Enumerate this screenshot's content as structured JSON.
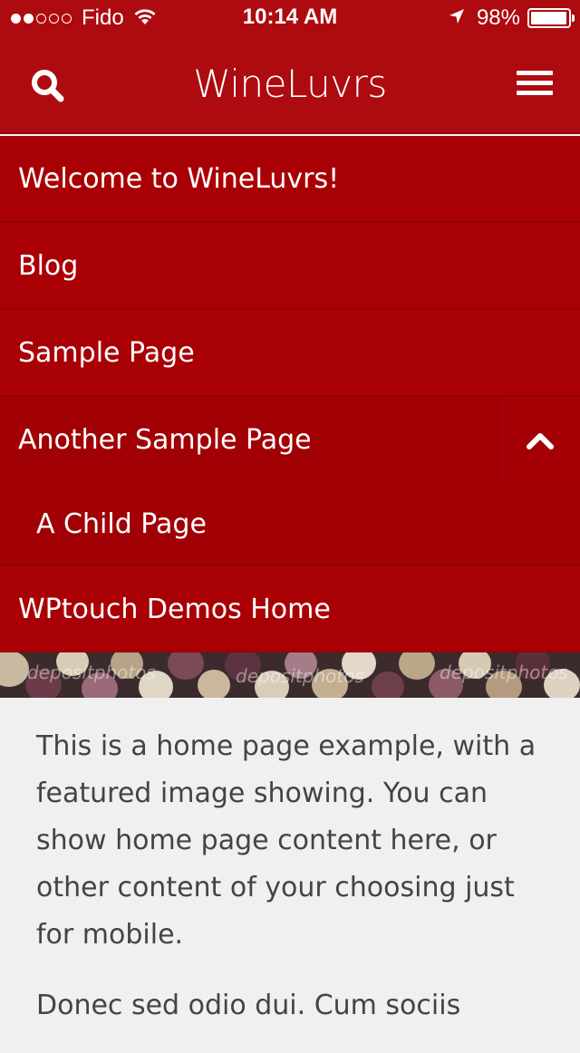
{
  "status_bar": {
    "signal_bars_filled": 2,
    "signal_bars_total": 5,
    "carrier": "Fido",
    "time": "10:14 AM",
    "battery_text": "98%",
    "battery_level": 0.98
  },
  "header": {
    "title": "WineLuvrs",
    "icons": {
      "search": "search-icon",
      "menu": "hamburger-menu-icon"
    }
  },
  "nav": {
    "items": [
      {
        "label": "Welcome to WineLuvrs!"
      },
      {
        "label": "Blog"
      },
      {
        "label": "Sample Page"
      },
      {
        "label": "Another Sample Page",
        "expanded": true,
        "toggle_icon": "chevron-up-icon"
      },
      {
        "label": "A Child Page"
      },
      {
        "label": "WPtouch Demos Home"
      }
    ]
  },
  "featured_image": {
    "watermarks": [
      "depositphotos",
      "depositphotos",
      "depositphotos"
    ]
  },
  "content": {
    "paragraph_1": "This is a home page example, with a featured image showing. You can show home page content here, or other content of your choosing just for mobile.",
    "paragraph_2": "Donec sed odio dui. Cum sociis"
  },
  "colors": {
    "brand_red": "#ad0b0f",
    "menu_red": "#a90006",
    "body_bg": "#f0f0f0",
    "text": "#444444"
  }
}
